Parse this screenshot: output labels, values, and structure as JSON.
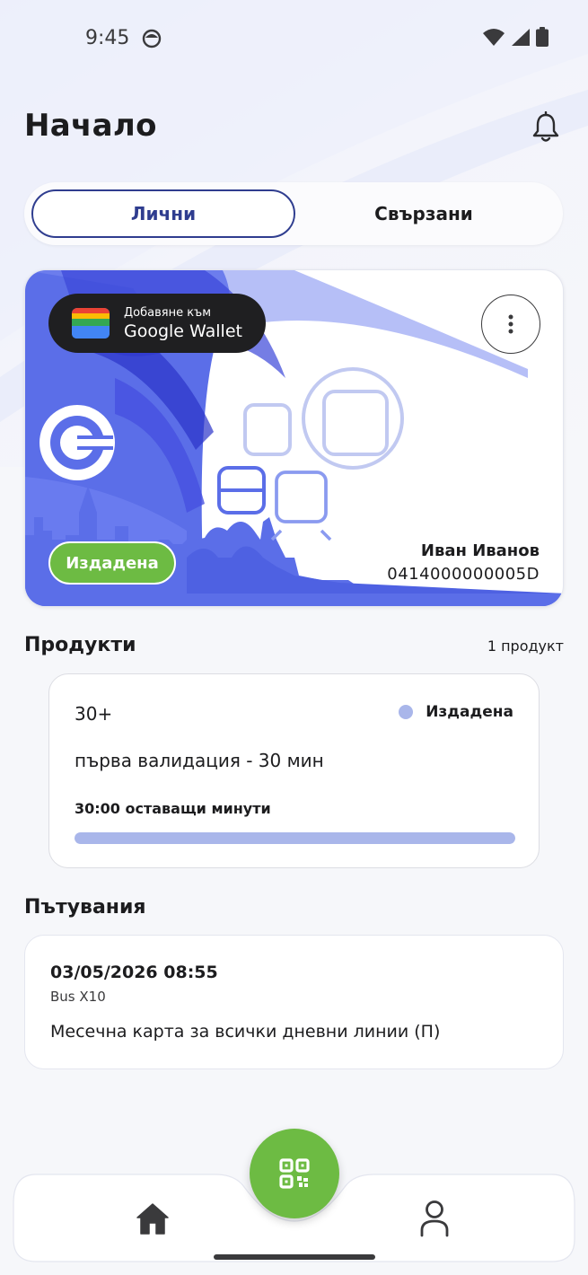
{
  "status_bar": {
    "time": "9:45"
  },
  "header": {
    "title": "Начало"
  },
  "tabs": [
    {
      "label": "Лични",
      "active": true
    },
    {
      "label": "Свързани",
      "active": false
    }
  ],
  "card": {
    "wallet_line1": "Добавяне към",
    "wallet_line2": "Google Wallet",
    "status": "Издадена",
    "holder_name": "Иван Иванов",
    "number": "0414000000005D"
  },
  "products": {
    "title": "Продукти",
    "count": "1 продукт",
    "items": [
      {
        "name": "30+",
        "status": "Издадена",
        "description": "първа валидация - 30 мин",
        "remaining": "30:00 оставащи минути",
        "progress": 1.0
      }
    ]
  },
  "trips": {
    "title": "Пътувания",
    "items": [
      {
        "datetime": "03/05/2026 08:55",
        "line": "Bus X10",
        "product": "Месечна карта за всички дневни линии (П)"
      }
    ]
  },
  "colors": {
    "accent_green": "#6dbb43",
    "accent_navy": "#2f3d8f",
    "card_blue": "#5b6ee8",
    "progress": "#a9b6ea"
  },
  "icons": {
    "notification": "bell-icon",
    "more": "more-vertical-icon",
    "scan": "qr-code-icon",
    "home": "home-icon",
    "profile": "person-icon"
  }
}
